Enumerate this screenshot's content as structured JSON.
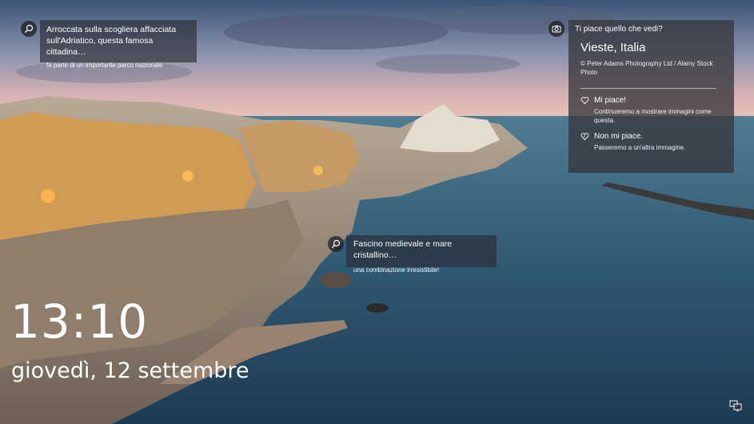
{
  "hotspots": [
    {
      "title": "Arroccata sulla scogliera affacciata sull'Adriatico, questa famosa cittadina…",
      "subtitle": "fa parte di un importante parco nazionale"
    },
    {
      "title": "Fascino medievale e mare cristallino…",
      "subtitle": "una combinazione irresistibile!"
    }
  ],
  "info": {
    "question": "Ti piace quello che vedi?",
    "place": "Vieste, Italia",
    "credit": "© Peter Adams Photography Ltd / Alamy Stock Photo",
    "like_label": "Mi piace!",
    "like_desc": "Continueremo a mostrare immagini come questa.",
    "dislike_label": "Non mi piace.",
    "dislike_desc": "Passeremo a un'altra immagine."
  },
  "clock": {
    "time": "13:10",
    "date": "giovedì, 12 settembre"
  },
  "icons": {
    "hotspot": "search-icon",
    "info": "camera-icon",
    "like": "heart-icon",
    "dislike": "heart-outline-icon",
    "network": "network-icon"
  }
}
